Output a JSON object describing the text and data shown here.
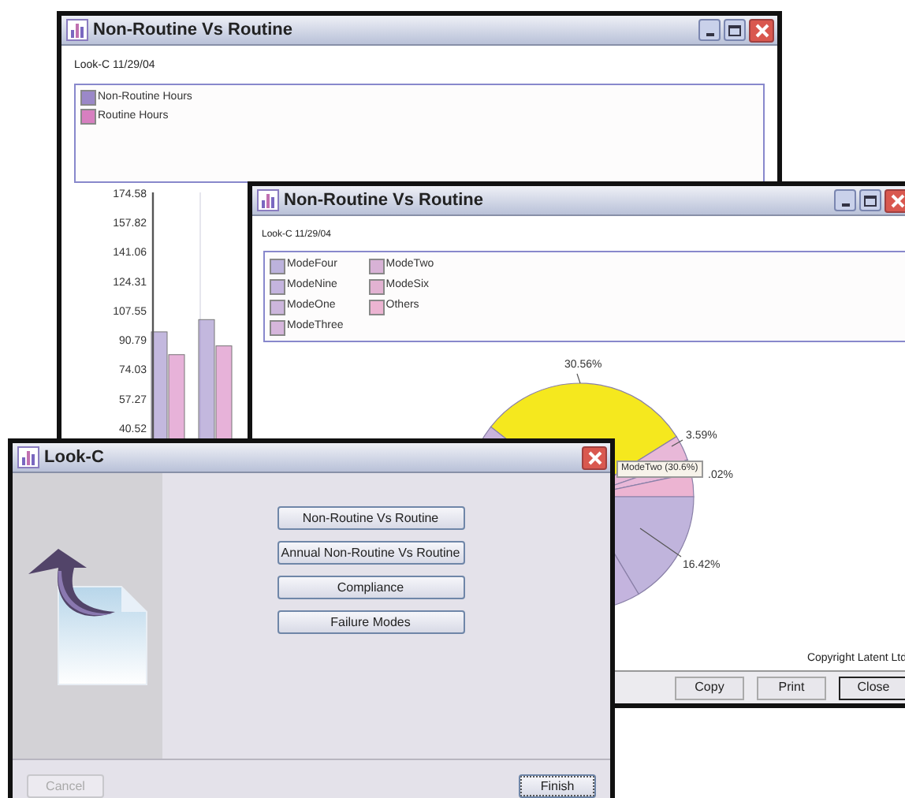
{
  "windows": [
    {
      "kind": "chart",
      "title": "Non-Routine Vs Routine",
      "subtitle": "Look-C 11/29/04",
      "chart_data": {
        "type": "bar",
        "categories": [
          null,
          null
        ],
        "ylim": [
          20.7,
          174.58
        ],
        "yticks": [
          174.58,
          157.82,
          141.06,
          124.31,
          107.55,
          90.79,
          74.03,
          57.27,
          40.52
        ],
        "series": [
          {
            "name": "Non-Routine Hours",
            "color": "#9b88c8",
            "values": [
              95,
              102
            ]
          },
          {
            "name": "Routine Hours",
            "color": "#d77fc0",
            "values": [
              82,
              87
            ]
          }
        ]
      }
    },
    {
      "kind": "pie",
      "title": "Non-Routine Vs Routine",
      "subtitle": "Look-C 11/29/04",
      "legend": [
        {
          "label": "ModeFour",
          "color": "#bcb2dc"
        },
        {
          "label": "ModeNine",
          "color": "#c4b4de"
        },
        {
          "label": "ModeOne",
          "color": "#ccb6dc"
        },
        {
          "label": "ModeThree",
          "color": "#d6b6dc"
        },
        {
          "label": "ModeTwo",
          "color": "#d8b2d6"
        },
        {
          "label": "ModeSix",
          "color": "#e2b2d2"
        },
        {
          "label": "Others",
          "color": "#ecb4d2"
        }
      ],
      "pie_labels": [
        "30.56%",
        "3.59%",
        ".02%",
        "16.42%"
      ],
      "tooltip": "ModeTwo (30.6%)",
      "copyright": "Copyright Latent Ltd",
      "buttons": [
        {
          "label": "Copy",
          "default": false
        },
        {
          "label": "Print",
          "default": false
        },
        {
          "label": "Close",
          "default": true
        }
      ]
    },
    {
      "kind": "wizard",
      "title": "Look-C",
      "actions": [
        "Non-Routine Vs Routine",
        "Annual Non-Routine Vs Routine",
        "Compliance",
        "Failure Modes"
      ],
      "footer": [
        {
          "label": "Cancel",
          "disabled": true
        },
        {
          "label": "Finish",
          "disabled": false
        }
      ]
    }
  ]
}
